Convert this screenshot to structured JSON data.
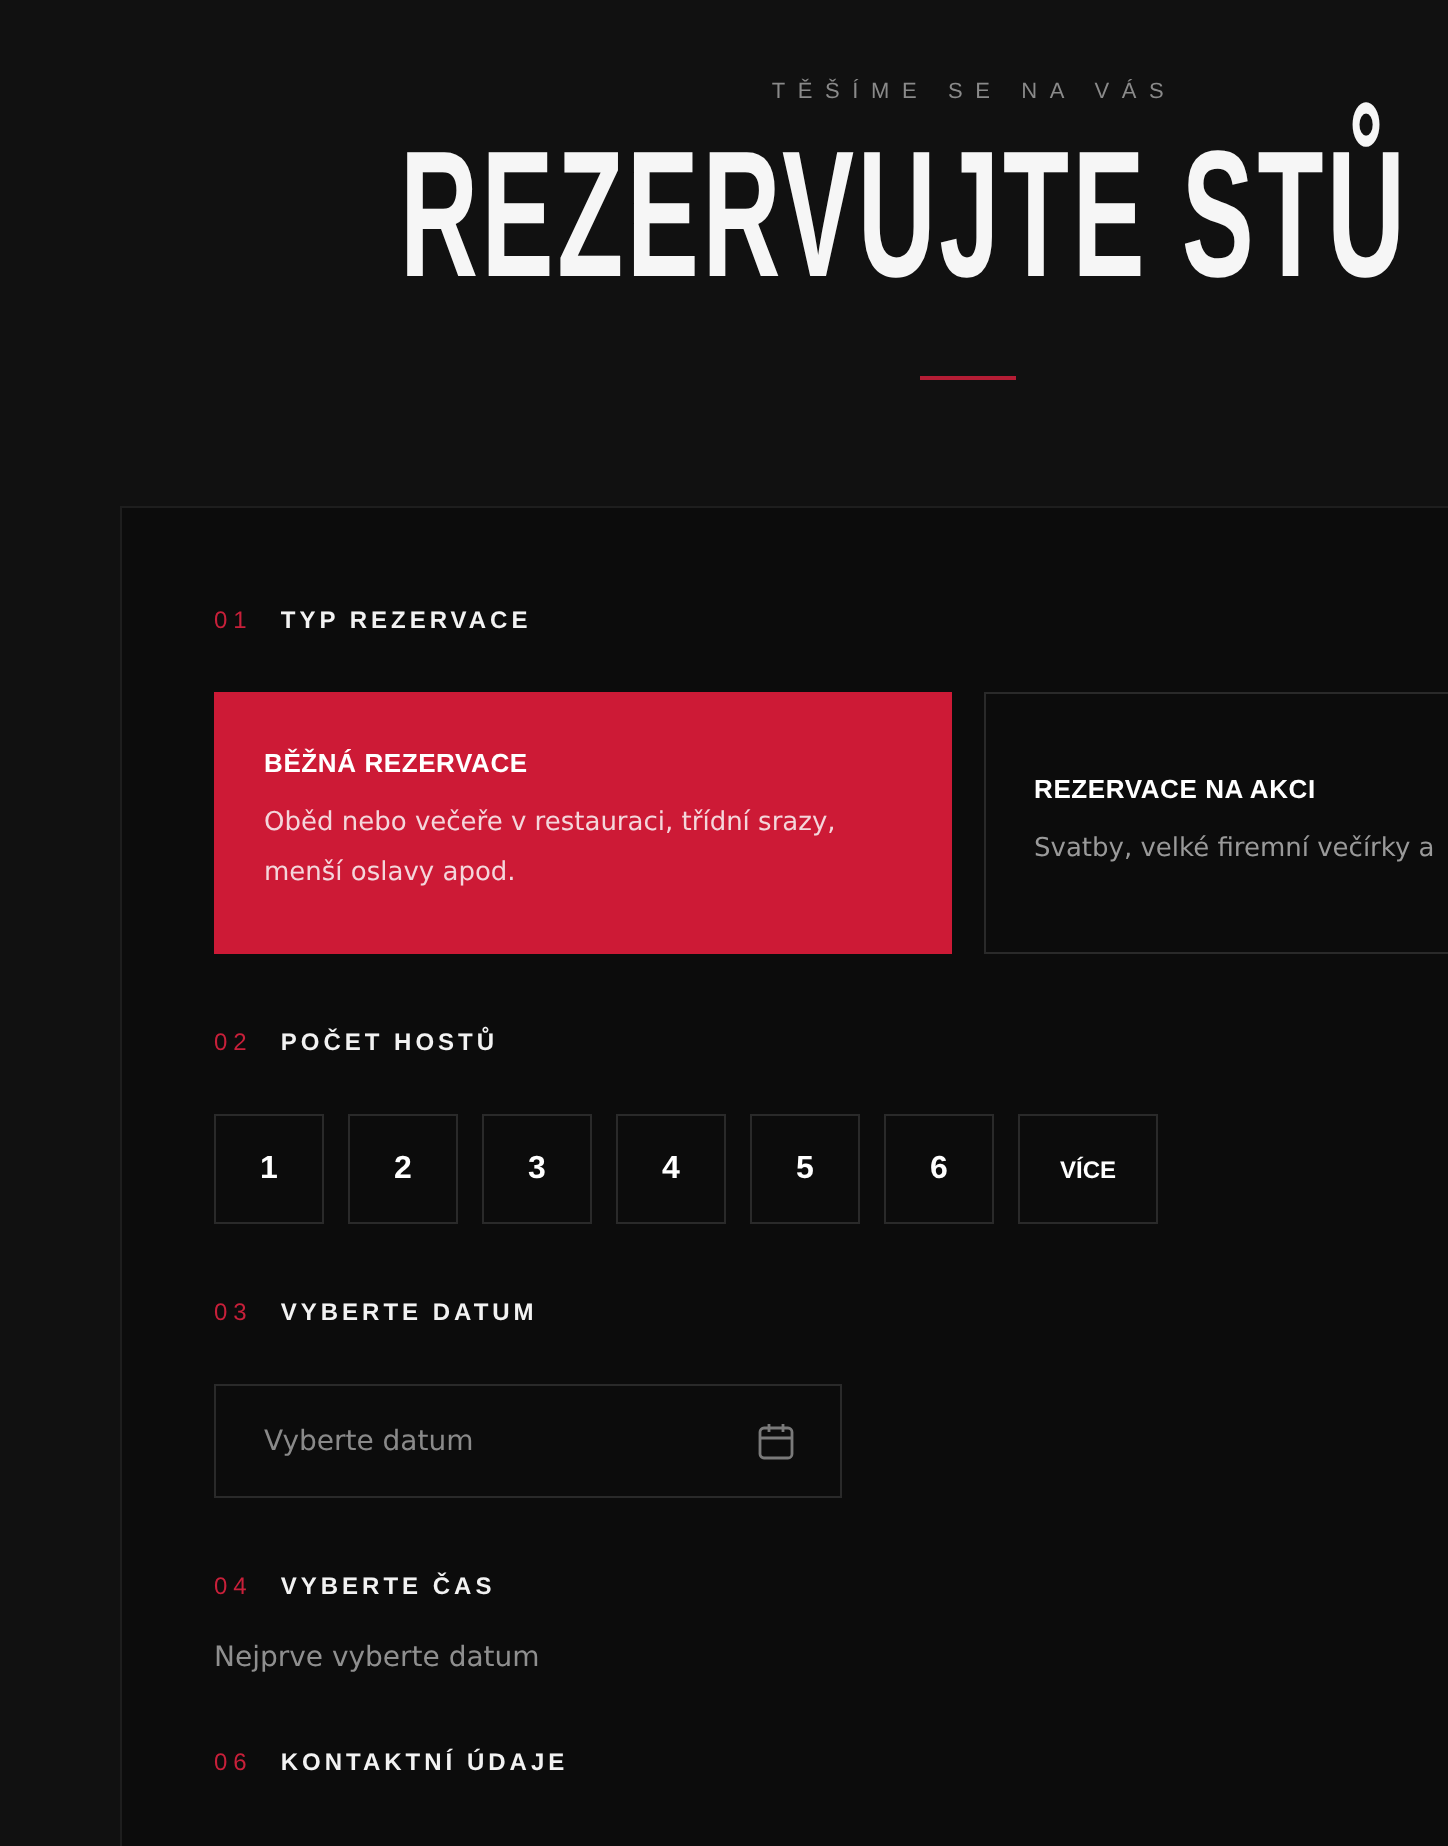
{
  "header": {
    "eyebrow": "TĚŠÍME SE NA VÁS",
    "title": "REZERVUJTE STŮ"
  },
  "sections": [
    {
      "kind": "type",
      "number": "01",
      "label": "TYP REZERVACE",
      "options": [
        {
          "title": "BĚŽNÁ REZERVACE",
          "description": "Oběd nebo večeře v restauraci, třídní srazy, menší oslavy apod.",
          "selected": true
        },
        {
          "title": "REZERVACE NA AKCI",
          "description": "Svatby, velké firemní večírky a",
          "selected": false
        }
      ]
    },
    {
      "kind": "guests",
      "number": "02",
      "label": "POČET HOSTŮ",
      "options": [
        {
          "label": "1",
          "selected": false
        },
        {
          "label": "2",
          "selected": false
        },
        {
          "label": "3",
          "selected": false
        },
        {
          "label": "4",
          "selected": false
        },
        {
          "label": "5",
          "selected": false
        },
        {
          "label": "6",
          "selected": false
        },
        {
          "label": "VÍCE",
          "selected": false
        }
      ]
    },
    {
      "kind": "date",
      "number": "03",
      "label": "VYBERTE DATUM",
      "placeholder": "Vyberte datum"
    },
    {
      "kind": "note",
      "number": "04",
      "label": "VYBERTE ČAS",
      "text": "Nejprve vyberte datum"
    },
    {
      "kind": "heading",
      "number": "06",
      "label": "KONTAKTNÍ ÚDAJE"
    }
  ]
}
